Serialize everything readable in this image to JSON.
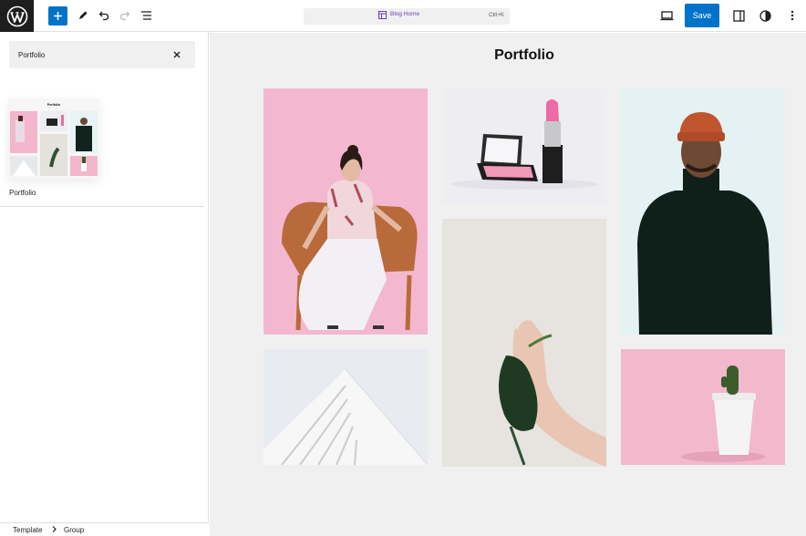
{
  "header": {
    "document_title": "Blog Home",
    "shortcut": "Ctrl+K",
    "save_label": "Save"
  },
  "sidebar": {
    "search": {
      "value": "Portfolio",
      "placeholder": "Search"
    },
    "patterns": [
      {
        "label": "Portfolio",
        "preview_title": "Portfolio"
      }
    ]
  },
  "breadcrumb": [
    "Template",
    "Group"
  ],
  "canvas": {
    "title": "Portfolio"
  },
  "colors": {
    "accent": "#0073c9",
    "logo_bg": "#1e1e1e",
    "pink": "#f3b6cc",
    "canvas_bg": "#f0f0f0"
  }
}
